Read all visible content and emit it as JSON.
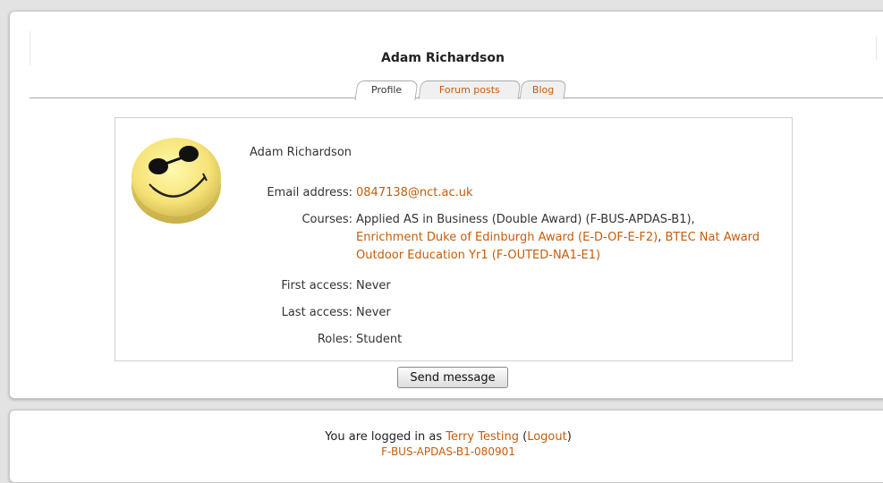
{
  "user": {
    "full_name": "Adam Richardson"
  },
  "tabs": [
    {
      "label": "Profile",
      "active": true
    },
    {
      "label": "Forum posts",
      "active": false
    },
    {
      "label": "Blog",
      "active": false
    }
  ],
  "profile": {
    "display_name": "Adam Richardson",
    "avatar_icon": "smiley-sunglasses-icon",
    "fields": {
      "email": {
        "label": "Email address:",
        "value": "0847138@nct.ac.uk"
      },
      "courses": {
        "label": "Courses:",
        "items": [
          {
            "text": "Applied AS in Business (Double Award) (F-BUS-APDAS-B1)",
            "link": false,
            "suffix": ","
          },
          {
            "text": "Enrichment Duke of Edinburgh Award (E-D-OF-E-F2)",
            "link": true,
            "suffix": ","
          },
          {
            "text": "BTEC Nat Award Outdoor Education Yr1 (F-OUTED-NA1-E1)",
            "link": true,
            "suffix": ""
          }
        ]
      },
      "first_access": {
        "label": "First access:",
        "value": "Never"
      },
      "last_access": {
        "label": "Last access:",
        "value": "Never"
      },
      "roles": {
        "label": "Roles:",
        "value": "Student"
      }
    }
  },
  "actions": {
    "send_message": "Send message"
  },
  "footer": {
    "logged_in_prefix": "You are logged in as",
    "user_link": "Terry Testing",
    "logout_link": "Logout",
    "course_link": "F-BUS-APDAS-B1-080901"
  },
  "colors": {
    "link": "#c65c0a",
    "background": "#e3e3e3"
  }
}
